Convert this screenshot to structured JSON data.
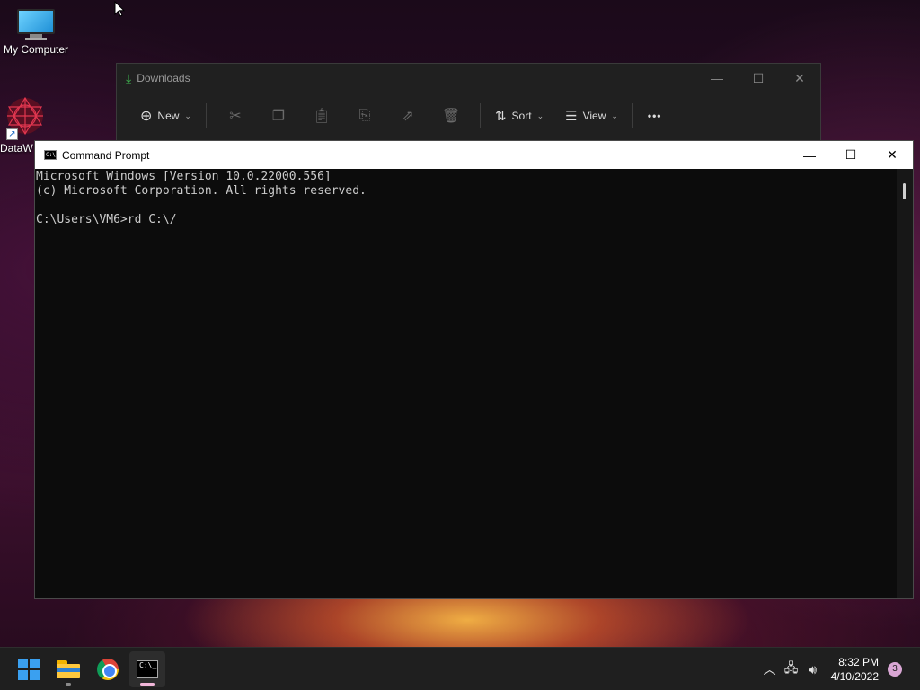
{
  "desktop": {
    "icons": [
      {
        "label": "My Computer",
        "icon": "monitor-icon"
      },
      {
        "label": "DataW",
        "icon": "datawrapper-icon"
      }
    ]
  },
  "explorer": {
    "title": "Downloads",
    "toolbar": {
      "new_label": "New",
      "sort_label": "Sort",
      "view_label": "View",
      "more_label": "•••"
    }
  },
  "cmd": {
    "title": "Command Prompt",
    "lines": [
      "Microsoft Windows [Version 10.0.22000.556]",
      "(c) Microsoft Corporation. All rights reserved.",
      "",
      "C:\\Users\\VM6>rd C:\\/"
    ]
  },
  "taskbar": {
    "apps": [
      "start",
      "file-explorer",
      "chrome",
      "command-prompt"
    ],
    "active_app": "command-prompt"
  },
  "tray": {
    "time": "8:32 PM",
    "date": "4/10/2022",
    "notification_count": "3"
  },
  "colors": {
    "terminal_bg": "#0c0c0c",
    "terminal_text": "#cccccc",
    "taskbar_bg": "#1f1f1f",
    "accent": "#3aa0f0"
  }
}
